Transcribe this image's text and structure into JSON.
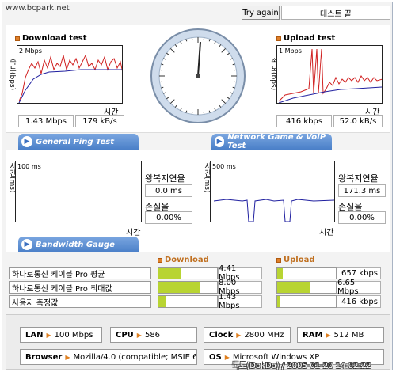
{
  "header": {
    "url": "www.bcpark.net",
    "try_again": "Try again",
    "test_status": "테스트 끝"
  },
  "download": {
    "title": "Download test",
    "axis_label": "속도(bps)",
    "scale": "2 Mbps",
    "time_label": "시간",
    "mbps": "1.43 Mbps",
    "kbs": "179 kB/s"
  },
  "upload": {
    "title": "Upload test",
    "axis_label": "속도(bps)",
    "scale": "1 Mbps",
    "time_label": "시간",
    "kbps": "416 kbps",
    "kbs": "52.0 kB/s"
  },
  "ping": {
    "tab": "General Ping Test",
    "axis_label": "시간(ms)",
    "scale": "100 ms",
    "time_label": "시간",
    "rtt_label": "왕복지연율",
    "rtt": "0.0 ms",
    "loss_label": "손실율",
    "loss": "0.00%"
  },
  "game": {
    "tab": "Network Game & VoIP Test",
    "axis_label": "시간(ms)",
    "scale": "500 ms",
    "time_label": "시간",
    "rtt_label": "왕복지연율",
    "rtt": "171.3 ms",
    "loss_label": "손실율",
    "loss": "0.00%"
  },
  "gauge": {
    "tab": "Bandwidth Gauge",
    "download_head": "Download",
    "upload_head": "Upload",
    "rows": [
      {
        "label": "하나로통신 케이블 Pro 평균",
        "down": "4.41 Mbps",
        "down_frac": 0.38,
        "up": "657 kbps",
        "up_frac": 0.1
      },
      {
        "label": "하나로통신 케이블 Pro 최대값",
        "down": "8.00 Mbps",
        "down_frac": 0.7,
        "up": "6.65 Mbps",
        "up_frac": 0.55
      },
      {
        "label": "사용자 측정값",
        "down": "1.43 Mbps",
        "down_frac": 0.12,
        "up": "416 kbps",
        "up_frac": 0.06
      }
    ]
  },
  "sysinfo": {
    "lan_label": "LAN",
    "lan": "100 Mbps",
    "cpu_label": "CPU",
    "cpu": "586",
    "clock_label": "Clock",
    "clock": "2800 MHz",
    "ram_label": "RAM",
    "ram": "512 MB",
    "browser_label": "Browser",
    "browser": "Mozilla/4.0 (compatible; MSIE 6.0",
    "os_label": "OS",
    "os": "Microsoft Windows XP"
  },
  "watermark": "둑도(DokDo) / 2005-01-20 14:02:22",
  "colors": {
    "accent": "#4a7fc8",
    "bar": "#b8d432",
    "download_line": "#d02020",
    "avg_line": "#2020a0"
  }
}
